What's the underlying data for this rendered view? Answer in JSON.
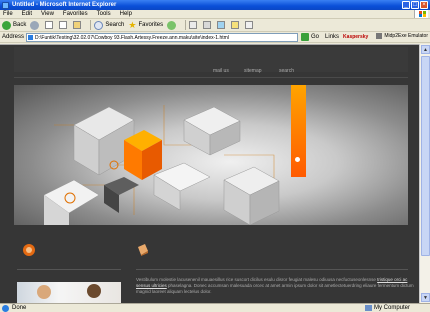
{
  "window": {
    "title": "Untitled - Microsoft Internet Explorer"
  },
  "menu": [
    "File",
    "Edit",
    "View",
    "Favorites",
    "Tools",
    "Help"
  ],
  "toolbar": {
    "back": "Back",
    "search": "Search",
    "favorites": "Favorites"
  },
  "address": {
    "label": "Address",
    "value": "D:\\Funtik\\Testing\\32.02.07\\Cowboy 93.Flash.Artessy.Freeze.ann.maku\\site\\index-1.html",
    "go": "Go",
    "links": "Links",
    "addon": "Kaspersky",
    "midp": "Midp2Exe Emulator"
  },
  "site": {
    "nav": [
      "mail us",
      "sitemap",
      "search"
    ],
    "lorem": "Vestibulum molestie lacusenenil mauaesillus rice suscort dicilus esulu disror feugiat malesu odiuusa necfuctuseonlesnse",
    "lorem_link": "tristique orci ac sensus ultricies",
    "lorem2": "phaselagna. Donec accumsan malesuada orcec at amet armin ipsum dolor sit ametlectetuerdring eliaure fermentum dictum magnid laoreet aliquam lectelus dolor."
  },
  "status": {
    "left": "Done",
    "zone": "My Computer"
  }
}
